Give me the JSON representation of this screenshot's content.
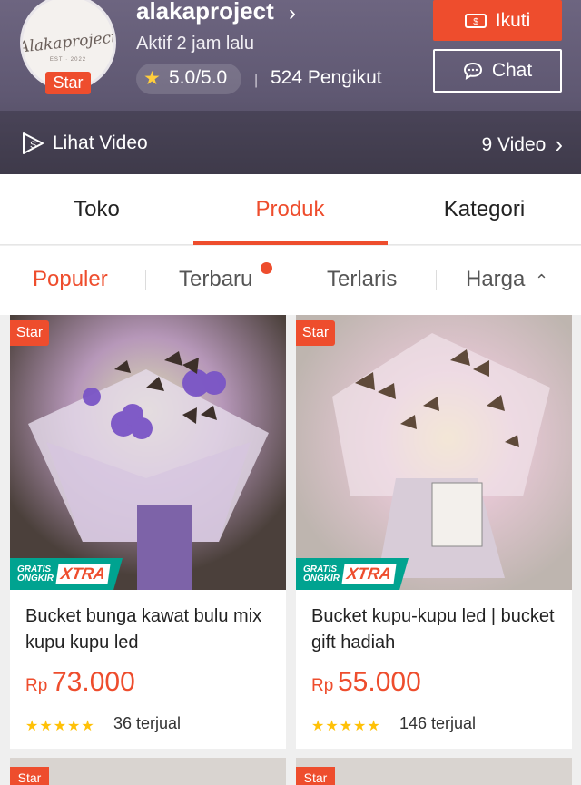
{
  "shop": {
    "logo_text": "Alakaproject",
    "logo_sub": "EST · 2022",
    "star_badge": "Star",
    "name": "alakaproject",
    "active": "Aktif 2 jam lalu",
    "rating": "5.0/5.0",
    "followers": "524 Pengikut",
    "follow_label": "Ikuti",
    "chat_label": "Chat"
  },
  "video": {
    "left_label": "Lihat Video",
    "right_label": "9 Video"
  },
  "tabs": [
    {
      "label": "Toko"
    },
    {
      "label": "Produk"
    },
    {
      "label": "Kategori"
    }
  ],
  "sorts": [
    {
      "label": "Populer"
    },
    {
      "label": "Terbaru"
    },
    {
      "label": "Terlaris"
    },
    {
      "label": "Harga"
    }
  ],
  "products": [
    {
      "badge": "Star",
      "ship_top": "GRATIS",
      "ship_bottom": "ONGKIR",
      "ship_xtra": "XTRA",
      "title": "Bucket bunga kawat bulu mix kupu kupu led",
      "currency": "Rp",
      "price": "73.000",
      "stars": "★★★★★",
      "sold": "36 terjual"
    },
    {
      "badge": "Star",
      "ship_top": "GRATIS",
      "ship_bottom": "ONGKIR",
      "ship_xtra": "XTRA",
      "title": "Bucket kupu-kupu led | bucket gift hadiah",
      "currency": "Rp",
      "price": "55.000",
      "stars": "★★★★★",
      "sold": "146 terjual"
    }
  ],
  "next_badges": [
    "Star",
    "Star"
  ],
  "colors": {
    "accent": "#ee4d2d",
    "header_bg": "#5f5872",
    "free_ship": "#00a390"
  },
  "icons": {
    "follow": "ticket-store-icon",
    "chat": "chat-bubble-icon",
    "video": "play-icon",
    "chevron": "chevron-right-icon",
    "sort_price": "sort-updown-icon"
  }
}
